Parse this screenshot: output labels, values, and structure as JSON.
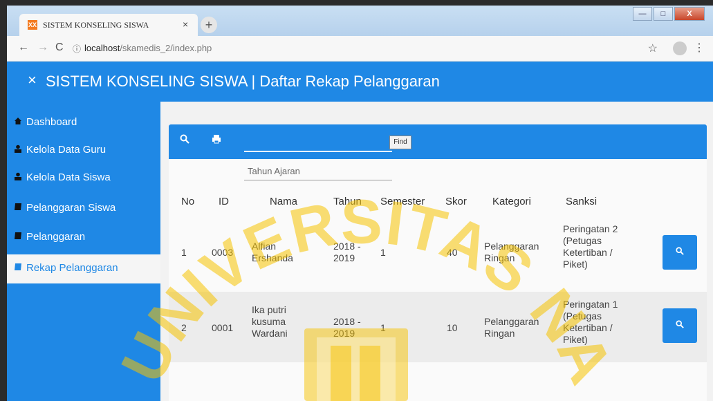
{
  "browser": {
    "tab_title": "SISTEM KONSELING SISWA",
    "favicon_text": "XX",
    "tab_close": "×",
    "new_tab": "+",
    "url_host": "localhost",
    "url_path": "/skamedis_2/index.php"
  },
  "window_buttons": {
    "minimize": "—",
    "maximize": "□",
    "close": "X"
  },
  "header": {
    "close_icon": "×",
    "title": "SISTEM KONSELING SISWA | Daftar Rekap Pelanggaran"
  },
  "sidebar": {
    "items": [
      {
        "label": "Dashboard",
        "icon": "home-icon"
      },
      {
        "label": "Kelola Data Guru",
        "icon": "user-icon"
      },
      {
        "label": "Kelola Data Siswa",
        "icon": "user-icon"
      },
      {
        "label": "Pelanggaran Siswa",
        "icon": "book-icon"
      },
      {
        "label": "Pelanggaran",
        "icon": "book-icon"
      },
      {
        "label": "Rekap Pelanggaran",
        "icon": "book-icon",
        "active": true
      }
    ]
  },
  "toolbar": {
    "find_label": "Find",
    "search_icon": "search-icon",
    "print_icon": "print-icon"
  },
  "filter": {
    "tahun_label": "Tahun Ajaran"
  },
  "table": {
    "headers": [
      "No",
      "ID",
      "Nama",
      "Tahun",
      "Semester",
      "Skor",
      "Kategori",
      "Sanksi"
    ],
    "rows": [
      {
        "no": "1",
        "id": "0003",
        "nama": [
          "Alfian",
          "Ershanda"
        ],
        "tahun": [
          "2018 -",
          "2019"
        ],
        "semester": "1",
        "skor": "40",
        "kategori": [
          "Pelanggaran",
          "Ringan"
        ],
        "sanksi": [
          "Peringatan 2",
          "(Petugas",
          "Ketertiban /",
          "Piket)"
        ]
      },
      {
        "no": "2",
        "id": "0001",
        "nama": [
          "Ika putri",
          "kusuma",
          "Wardani"
        ],
        "tahun": [
          "2018 -",
          "2019"
        ],
        "semester": "1",
        "skor": "10",
        "kategori": [
          "Pelanggaran",
          "Ringan"
        ],
        "sanksi": [
          "Peringatan 1",
          "(Petugas",
          "Ketertiban /",
          "Piket)"
        ]
      }
    ]
  },
  "watermark": {
    "text": "UNIVERSITAS NAROTAMA"
  },
  "colors": {
    "primary": "#1f88e5",
    "watermark": "#f5c200"
  }
}
